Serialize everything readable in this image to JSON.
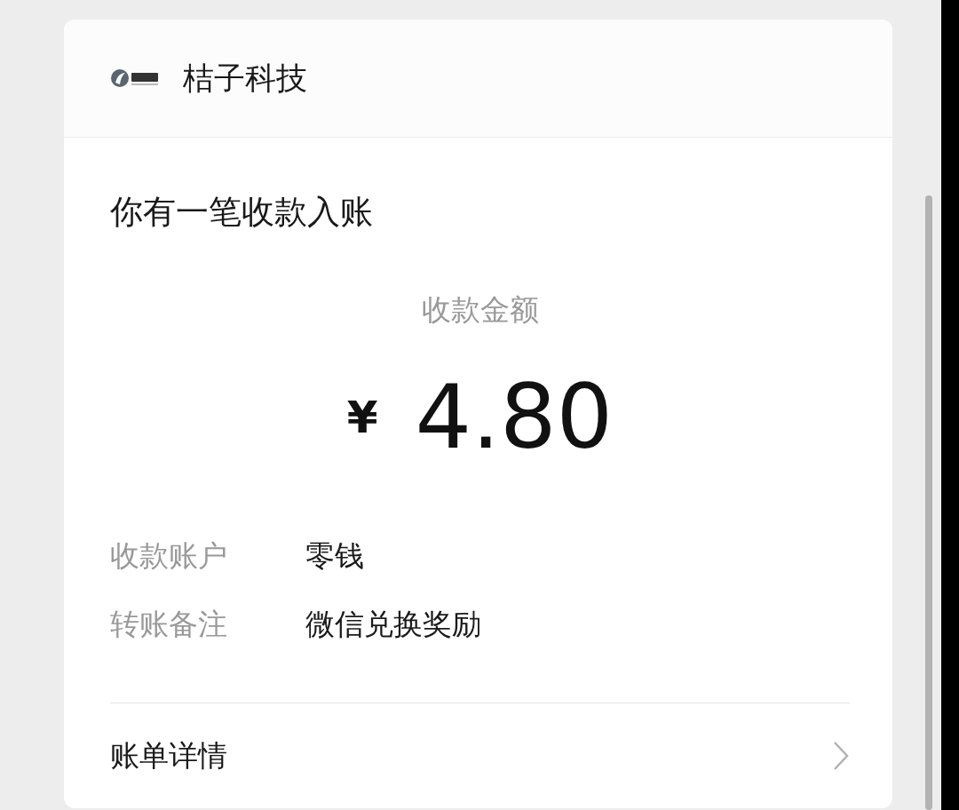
{
  "header": {
    "company": "桔子科技"
  },
  "notice": {
    "title": "你有一笔收款入账",
    "amount_label": "收款金额",
    "currency": "¥",
    "amount": "4.80"
  },
  "details": [
    {
      "label": "收款账户",
      "value": "零钱"
    },
    {
      "label": "转账备注",
      "value": "微信兑换奖励"
    }
  ],
  "link": {
    "label": "账单详情"
  }
}
